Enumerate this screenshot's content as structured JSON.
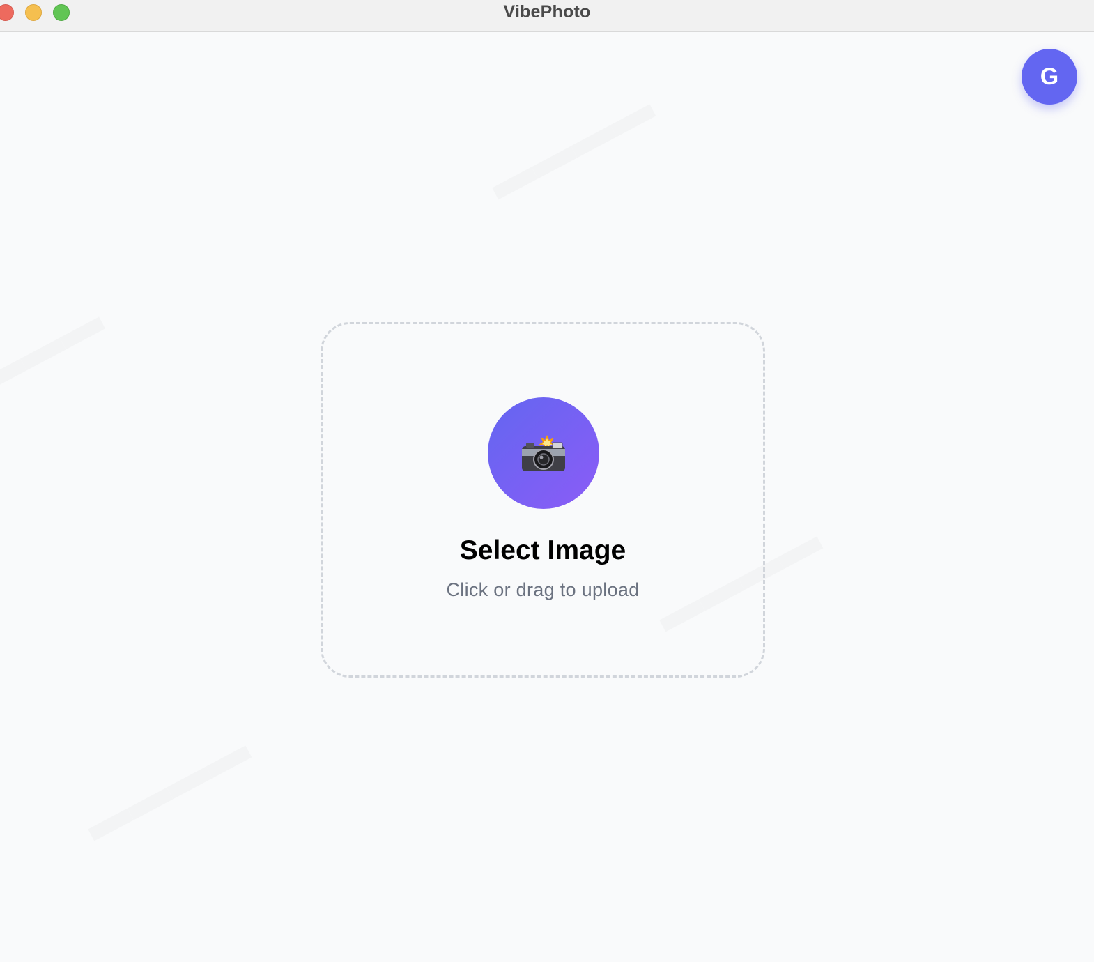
{
  "window": {
    "title": "VibePhoto"
  },
  "user": {
    "avatar_initial": "G",
    "avatar_color": "#6366f1"
  },
  "upload": {
    "title": "Select Image",
    "subtitle": "Click or drag to upload",
    "icon": "camera-flash-icon",
    "gradient_start": "#6366f1",
    "gradient_end": "#8b5cf6"
  },
  "colors": {
    "background": "#f9fafb",
    "dashed_border": "#d1d5db",
    "subtitle_text": "#6b7280"
  }
}
